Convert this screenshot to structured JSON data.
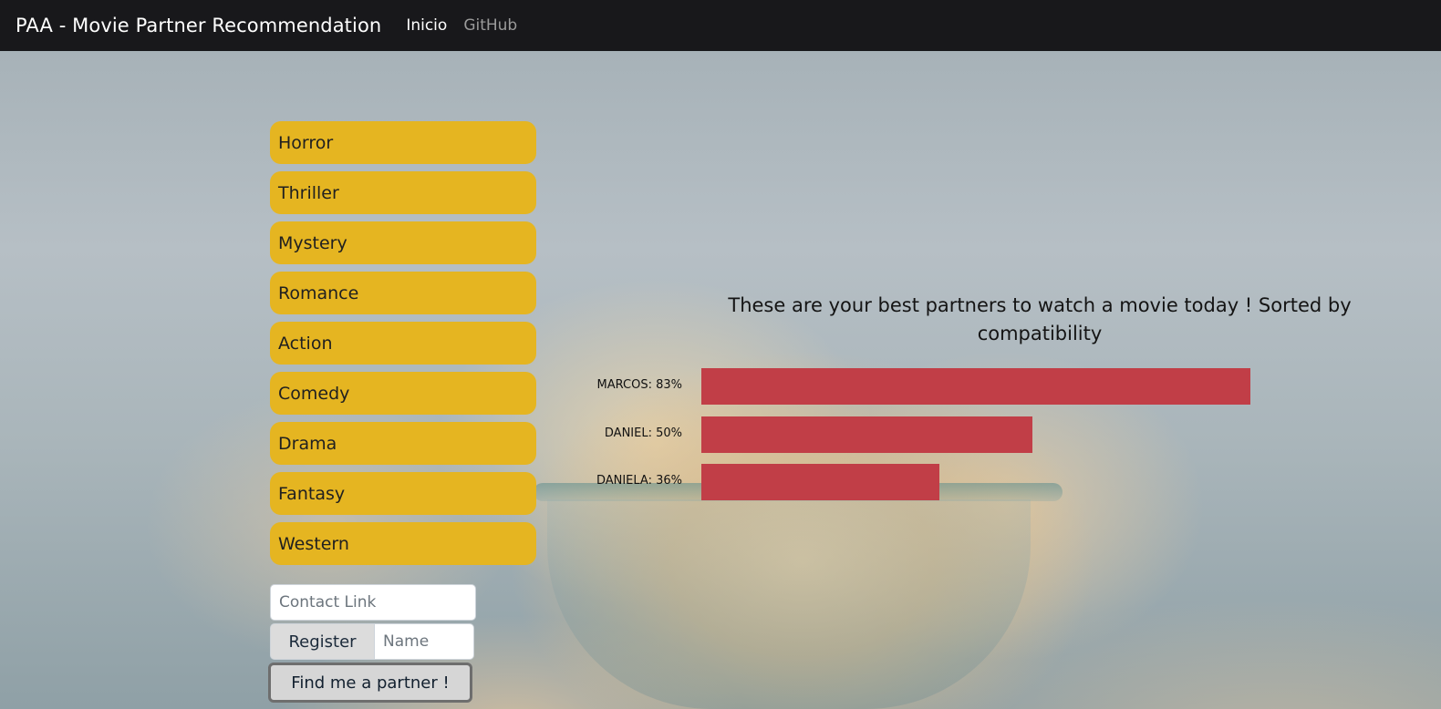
{
  "navbar": {
    "brand": "PAA - Movie Partner Recommendation",
    "links": [
      {
        "label": "Inicio",
        "active": true
      },
      {
        "label": "GitHub",
        "active": false
      }
    ]
  },
  "genres": [
    "Horror",
    "Thriller",
    "Mystery",
    "Romance",
    "Action",
    "Comedy",
    "Drama",
    "Fantasy",
    "Western"
  ],
  "form": {
    "contact_placeholder": "Contact Link",
    "register_label": "Register",
    "name_placeholder": "Name",
    "find_label": "Find me a partner !"
  },
  "results": {
    "title": "These are your best partners to watch a movie today ! Sorted by compatibility"
  },
  "chart_data": {
    "type": "bar",
    "orientation": "horizontal",
    "categories": [
      "MARCOS",
      "DANIEL",
      "DANIELA"
    ],
    "labels": [
      "MARCOS: 83%",
      "DANIEL: 50%",
      "DANIELA: 36%"
    ],
    "values": [
      83,
      50,
      36
    ],
    "unit": "%",
    "xlim": [
      0,
      100
    ],
    "bar_color": "#c13e47"
  },
  "colors": {
    "navbar_bg": "#18181b",
    "genre_button": "#e5b521",
    "bar": "#c13e47"
  }
}
